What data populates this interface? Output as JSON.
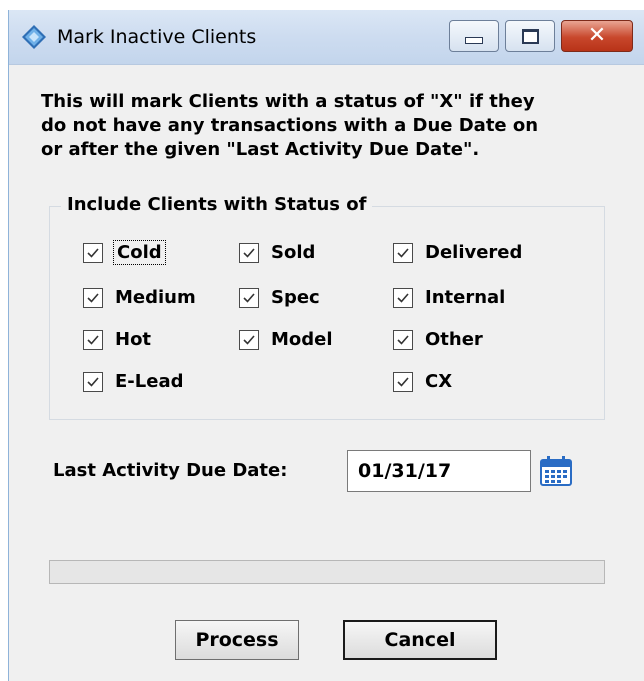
{
  "window": {
    "title": "Mark Inactive Clients",
    "controls": {
      "minimize_icon": "minimize-icon",
      "maximize_icon": "maximize-icon",
      "close_glyph": "✕"
    }
  },
  "description_lines": [
    "This will mark Clients with a status of \"X\" if they",
    "do not have any transactions with a Due Date on",
    " or after the given \"Last Activity Due Date\"."
  ],
  "status_group": {
    "legend": "Include Clients with Status of",
    "checkboxes": [
      {
        "label": "Cold",
        "checked": true
      },
      {
        "label": "Sold",
        "checked": true
      },
      {
        "label": "Delivered",
        "checked": true
      },
      {
        "label": "Medium",
        "checked": true
      },
      {
        "label": "Spec",
        "checked": true
      },
      {
        "label": "Internal",
        "checked": true
      },
      {
        "label": "Hot",
        "checked": true
      },
      {
        "label": "Model",
        "checked": true
      },
      {
        "label": "Other",
        "checked": true
      },
      {
        "label": "E-Lead",
        "checked": true
      },
      {
        "label": "CX",
        "checked": true
      }
    ]
  },
  "last_activity": {
    "label": "Last Activity Due Date:",
    "value": "01/31/17",
    "picker_icon": "calendar-icon"
  },
  "progress": {
    "value": 0
  },
  "buttons": {
    "process": "Process",
    "cancel": "Cancel"
  },
  "colors": {
    "titlebar": "#cddcf0",
    "close_button": "#c8472c",
    "dialog_bg": "#f0f0f0"
  }
}
